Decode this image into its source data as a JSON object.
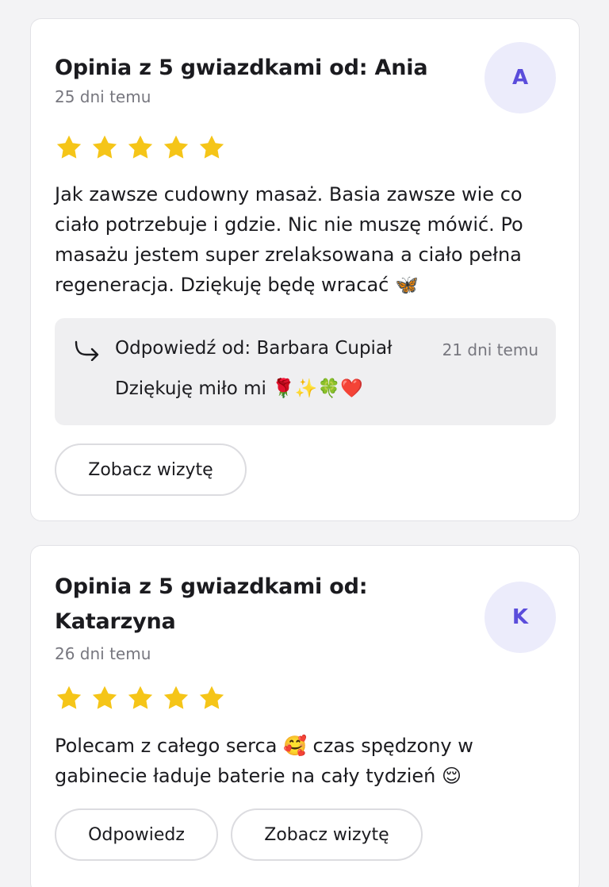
{
  "reviews": [
    {
      "title": "Opinia z 5 gwiazdkami od: Ania",
      "date": "25 dni temu",
      "avatar": "A",
      "rating": 5,
      "text": "Jak zawsze cudowny masaż. Basia zawsze wie co ciało potrzebuje i gdzie. Nic nie muszę mówić. Po masażu jestem super zrelaksowana a ciało pełna regeneracja. Dziękuję będę wracać 🦋",
      "reply": {
        "icon": "reply-arrow-icon",
        "author": "Odpowiedź od: Barbara Cupiał",
        "date": "21 dni temu",
        "text": "Dziękuję miło mi 🌹✨🍀❤️"
      },
      "visit_button": "Zobacz wizytę"
    },
    {
      "title": "Opinia z 5 gwiazdkami od: Katarzyna",
      "date": "26 dni temu",
      "avatar": "K",
      "rating": 5,
      "text": "Polecam z całego serca 🥰 czas spędzony w gabinecie ładuje baterie na cały tydzień 😌",
      "reply_button": "Odpowiedz",
      "visit_button": "Zobacz wizytę"
    }
  ],
  "colors": {
    "star": "#f5c518",
    "accent": "#5b4ddb",
    "avatar_bg": "#ececfb",
    "muted_text": "#77777f"
  }
}
